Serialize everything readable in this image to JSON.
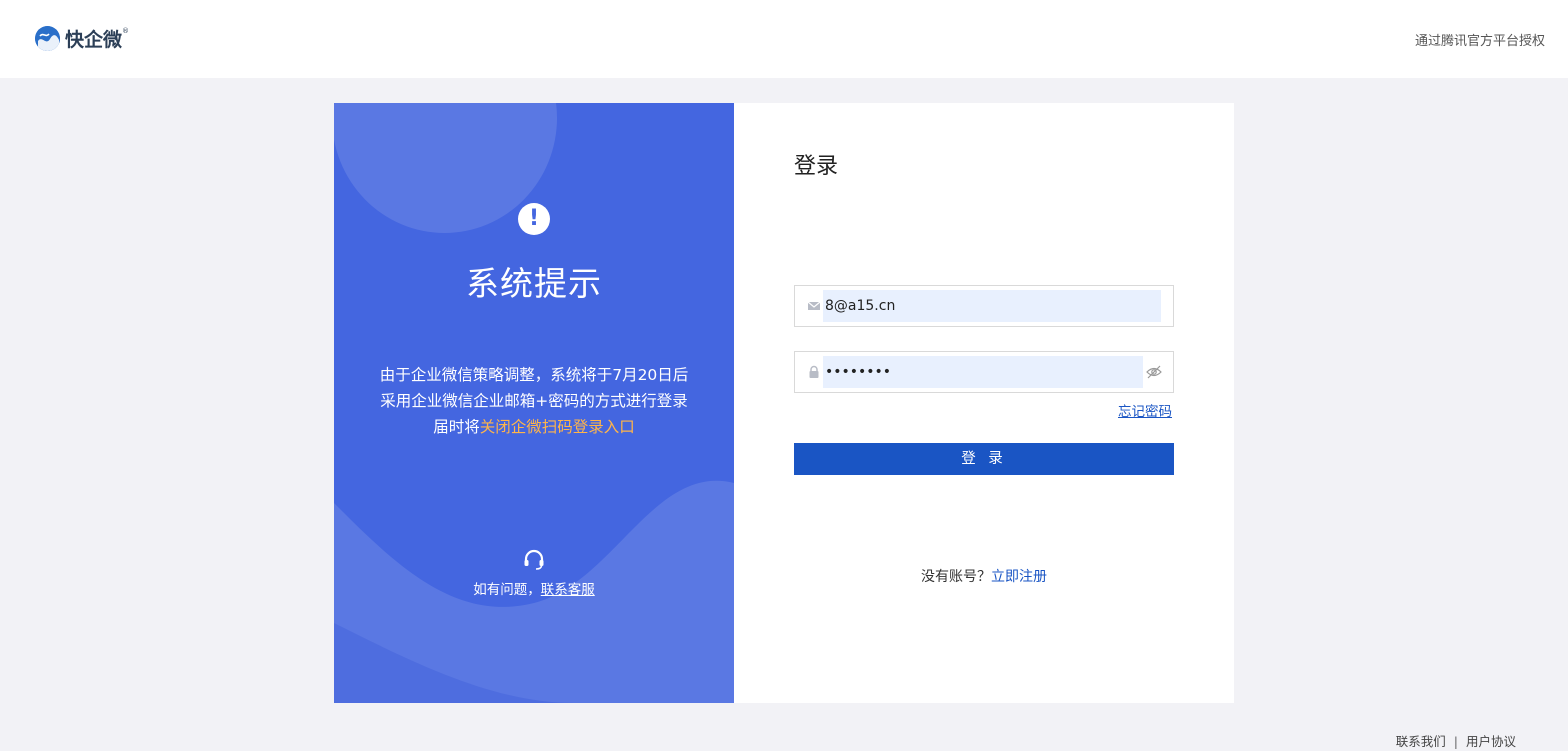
{
  "header": {
    "brand": "快企微",
    "brand_mark": "®",
    "auth_note": "通过腾讯官方平台授权"
  },
  "notice_panel": {
    "title": "系统提示",
    "line1": "由于企业微信策略调整，系统将于7月20日后",
    "line2": "采用企业微信企业邮箱+密码的方式进行登录",
    "line3_prefix": "届时将",
    "line3_highlight": "关闭企微扫码登录入口",
    "help_prefix": "如有问题，",
    "help_link": "联系客服",
    "highlight_color": "#ffb54a"
  },
  "login": {
    "title": "登录",
    "email_value": "8@a15.cn",
    "password_value": "12345678",
    "forgot": "忘记密码",
    "submit": "登 录",
    "no_account": "没有账号？",
    "register": "立即注册",
    "accent_color": "#1a55c4"
  },
  "footer": {
    "contact": "联系我们",
    "separator": "|",
    "agreement": "用户协议"
  }
}
